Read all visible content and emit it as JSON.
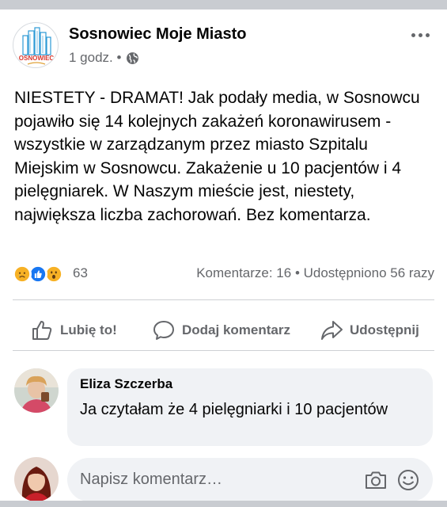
{
  "post": {
    "page_name": "Sosnowiec Moje Miasto",
    "logo_text": "OSNOWIEC",
    "time": "1 godz. •",
    "text": "NIESTETY - DRAMAT! Jak podały media, w Sosnowcu pojawiło się 14 kolejnych zakażeń koronawirusem - wszystkie w zarządzanym przez miasto Szpitalu Miejskim w Sosnowcu. Zakażenie u 10 pacjentów i 4 pielęgniarek. W Naszym mieście jest, niestety, największa liczba zachorowań. Bez komentarza."
  },
  "reactions": {
    "icons": [
      "sad-icon",
      "like-icon",
      "wow-icon"
    ],
    "count": "63",
    "stats": "Komentarze: 16 • Udostępniono 56 razy"
  },
  "actions": {
    "like": "Lubię to!",
    "comment": "Dodaj komentarz",
    "share": "Udostępnij"
  },
  "comment": {
    "author": "Eliza Szczerba",
    "text": "Ja czytałam że 4 pielęgniarki i 10 pacjentów"
  },
  "compose": {
    "placeholder": "Napisz komentarz…"
  },
  "colors": {
    "secondary_text": "#65676b",
    "bubble": "#f0f2f5",
    "like_blue": "#1877f2",
    "reaction_yellow": "#f7b125"
  }
}
